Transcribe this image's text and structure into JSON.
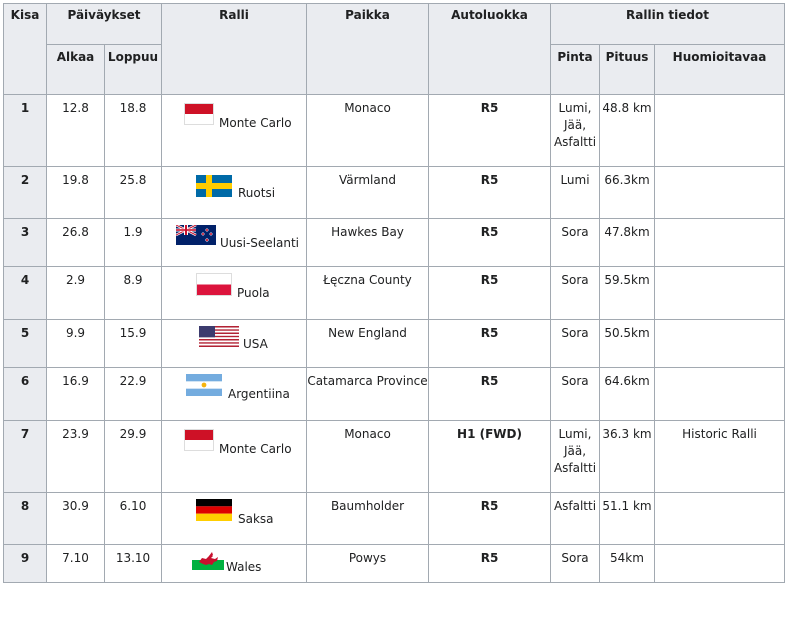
{
  "headers": {
    "kisa": "Kisa",
    "paivaykset": "Päiväykset",
    "ralli": "Ralli",
    "paikka": "Paikka",
    "autoluokka": "Autoluokka",
    "rallin_tiedot": "Rallin tiedot",
    "alkaa": "Alkaa",
    "loppuu": "Loppuu",
    "pinta": "Pinta",
    "pituus": "Pituus",
    "huomioitavaa": "Huomioitavaa"
  },
  "rows": [
    {
      "kisa": "1",
      "alkaa": "12.8",
      "loppuu": "18.8",
      "ralli": "Monte Carlo",
      "flag": "monaco-flag",
      "paikka": "Monaco",
      "luokka": "R5",
      "pinta": [
        "Lumi,",
        "Jää,",
        "Asfaltti"
      ],
      "pituus": "48.8 km",
      "huom": ""
    },
    {
      "kisa": "2",
      "alkaa": "19.8",
      "loppuu": "25.8",
      "ralli": "Ruotsi",
      "flag": "sweden-flag",
      "paikka": "Värmland",
      "luokka": "R5",
      "pinta": [
        "Lumi"
      ],
      "pituus": "66.3km",
      "huom": ""
    },
    {
      "kisa": "3",
      "alkaa": "26.8",
      "loppuu": "1.9",
      "ralli": "Uusi-Seelanti",
      "flag": "new-zealand-flag",
      "paikka": "Hawkes Bay",
      "luokka": "R5",
      "pinta": [
        "Sora"
      ],
      "pituus": "47.8km",
      "huom": ""
    },
    {
      "kisa": "4",
      "alkaa": "2.9",
      "loppuu": "8.9",
      "ralli": "Puola",
      "flag": "poland-flag",
      "paikka": "Łęczna County",
      "luokka": "R5",
      "pinta": [
        "Sora"
      ],
      "pituus": "59.5km",
      "huom": ""
    },
    {
      "kisa": "5",
      "alkaa": "9.9",
      "loppuu": "15.9",
      "ralli": "USA",
      "flag": "usa-flag",
      "paikka": "New England",
      "luokka": "R5",
      "pinta": [
        "Sora"
      ],
      "pituus": "50.5km",
      "huom": ""
    },
    {
      "kisa": "6",
      "alkaa": "16.9",
      "loppuu": "22.9",
      "ralli": "Argentiina",
      "flag": "argentina-flag",
      "paikka": "Catamarca Province",
      "luokka": "R5",
      "pinta": [
        "Sora"
      ],
      "pituus": "64.6km",
      "huom": ""
    },
    {
      "kisa": "7",
      "alkaa": "23.9",
      "loppuu": "29.9",
      "ralli": "Monte Carlo",
      "flag": "monaco-flag",
      "paikka": "Monaco",
      "luokka": "H1 (FWD)",
      "pinta": [
        "Lumi,",
        "Jää,",
        "Asfaltti"
      ],
      "pituus": "36.3 km",
      "huom": "Historic Ralli"
    },
    {
      "kisa": "8",
      "alkaa": "30.9",
      "loppuu": "6.10",
      "ralli": "Saksa",
      "flag": "germany-flag",
      "paikka": "Baumholder",
      "luokka": "R5",
      "pinta": [
        "Asfaltti"
      ],
      "pituus": "51.1 km",
      "huom": ""
    },
    {
      "kisa": "9",
      "alkaa": "7.10",
      "loppuu": "13.10",
      "ralli": "Wales",
      "flag": "wales-flag",
      "paikka": "Powys",
      "luokka": "R5",
      "pinta": [
        "Sora"
      ],
      "pituus": "54km",
      "huom": ""
    }
  ]
}
